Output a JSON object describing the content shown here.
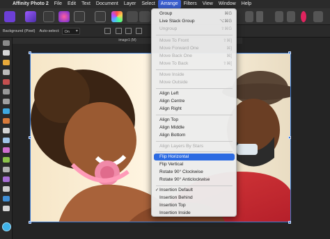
{
  "menubar": {
    "apple_icon": "apple-logo",
    "app_name": "Affinity Photo 2",
    "items": [
      "File",
      "Edit",
      "Text",
      "Document",
      "Layer",
      "Select",
      "Arrange",
      "Filters",
      "View",
      "Window",
      "Help"
    ],
    "active_item": "Arrange"
  },
  "context_toolbar": {
    "background_label": "Background (Pixel)",
    "autoselect_label": "Auto-select:",
    "autoselect_value": "On"
  },
  "document": {
    "tab_title": "image1 (M)"
  },
  "arrange_menu": {
    "items": [
      {
        "label": "Group",
        "shortcut": "⌘G",
        "enabled": true
      },
      {
        "label": "Live Stack Group",
        "shortcut": "⌥⌘G",
        "enabled": true
      },
      {
        "label": "Ungroup",
        "shortcut": "⇧⌘G",
        "enabled": false
      },
      {
        "label": "Move To Front",
        "shortcut": "⇧⌘]",
        "enabled": false
      },
      {
        "label": "Move Forward One",
        "shortcut": "⌘]",
        "enabled": false
      },
      {
        "label": "Move Back One",
        "shortcut": "⌘[",
        "enabled": false
      },
      {
        "label": "Move To Back",
        "shortcut": "⇧⌘[",
        "enabled": false
      },
      {
        "label": "Move Inside",
        "shortcut": "",
        "enabled": false
      },
      {
        "label": "Move Outside",
        "shortcut": "",
        "enabled": false
      },
      {
        "label": "Align Left",
        "shortcut": "",
        "enabled": true
      },
      {
        "label": "Align Centre",
        "shortcut": "",
        "enabled": true
      },
      {
        "label": "Align Right",
        "shortcut": "",
        "enabled": true
      },
      {
        "label": "Align Top",
        "shortcut": "",
        "enabled": true
      },
      {
        "label": "Align Middle",
        "shortcut": "",
        "enabled": true
      },
      {
        "label": "Align Bottom",
        "shortcut": "",
        "enabled": true
      },
      {
        "label": "Align Layers By Stars",
        "shortcut": "",
        "enabled": false
      },
      {
        "label": "Flip Horizontal",
        "shortcut": "",
        "enabled": true,
        "highlighted": true
      },
      {
        "label": "Flip Vertical",
        "shortcut": "",
        "enabled": true
      },
      {
        "label": "Rotate 90° Clockwise",
        "shortcut": "",
        "enabled": true
      },
      {
        "label": "Rotate 90° Anticlockwise",
        "shortcut": "",
        "enabled": true
      },
      {
        "label": "Insertion Default",
        "shortcut": "",
        "enabled": true,
        "checked": true
      },
      {
        "label": "Insertion Behind",
        "shortcut": "",
        "enabled": true
      },
      {
        "label": "Insertion Top",
        "shortcut": "",
        "enabled": true
      },
      {
        "label": "Insertion Inside",
        "shortcut": "",
        "enabled": true
      }
    ]
  },
  "colors": {
    "accent": "#2d6be2",
    "selection": "#3a7bd5"
  }
}
